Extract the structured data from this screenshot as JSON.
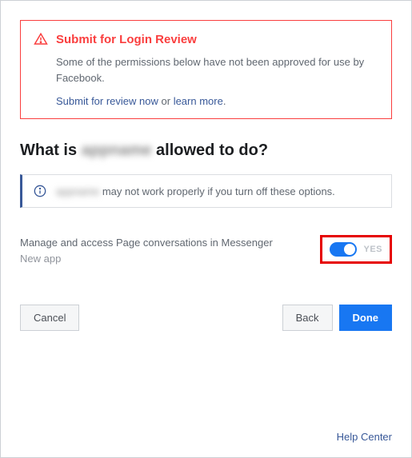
{
  "alert": {
    "title": "Submit for Login Review",
    "body": "Some of the permissions below have not been approved for use by Facebook.",
    "submit_link": "Submit for review now",
    "or_text": " or ",
    "learn_link": "learn more",
    "period": "."
  },
  "heading": {
    "prefix": "What is ",
    "app_name_blurred": "appname",
    "suffix": " allowed to do?"
  },
  "info": {
    "blurred_text": "appname",
    "text": " may not work properly if you turn off these options."
  },
  "permission": {
    "label": "Manage and access Page conversations in Messenger",
    "sub": "New app",
    "toggle_state": "YES"
  },
  "buttons": {
    "cancel": "Cancel",
    "back": "Back",
    "done": "Done"
  },
  "footer": {
    "help": "Help Center"
  }
}
